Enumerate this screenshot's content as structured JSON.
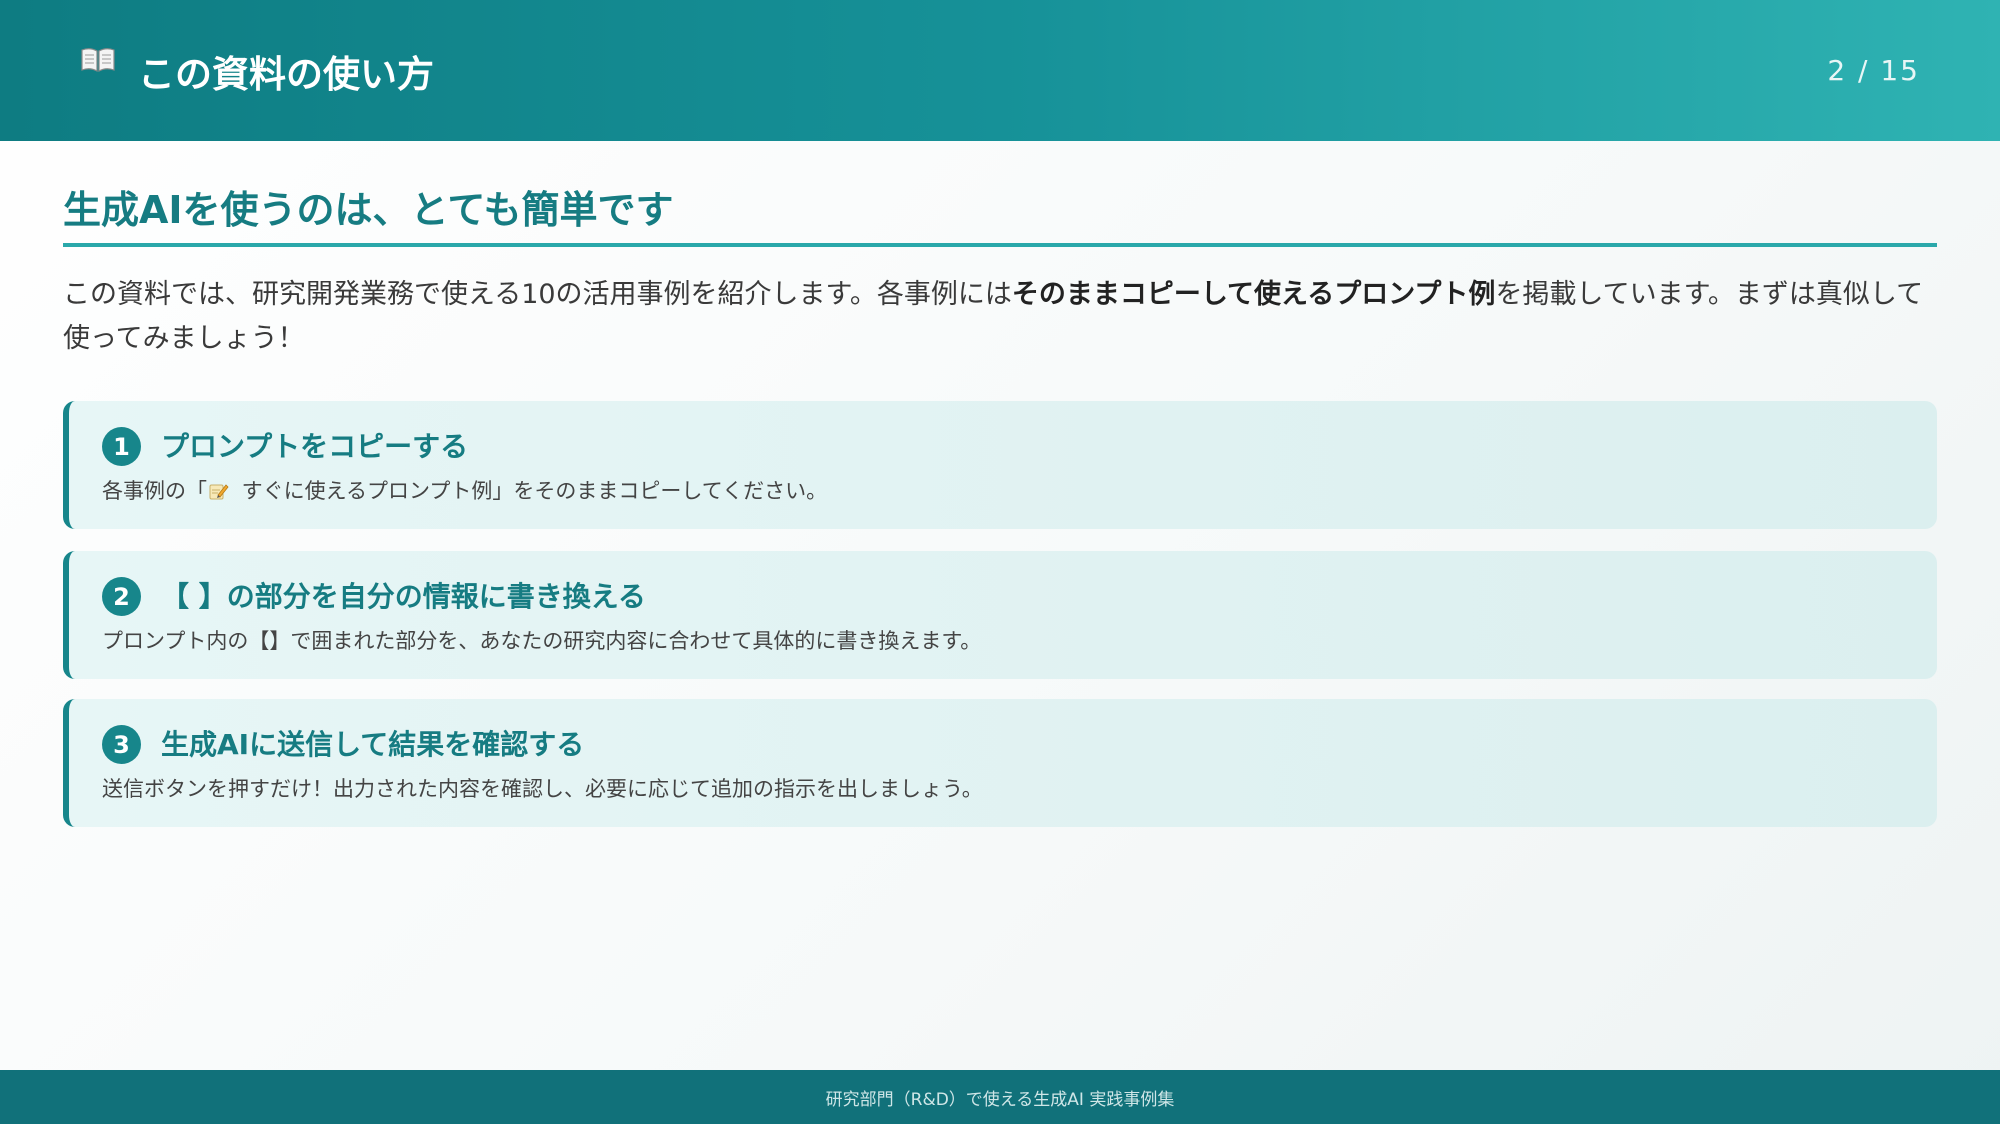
{
  "header": {
    "icon": "open-book-icon",
    "title": "この資料の使い方",
    "page": "2 / 15"
  },
  "main": {
    "subtitle": "生成AIを使うのは、とても簡単です",
    "intro": {
      "before": "この資料では、研究開発業務で使える10の活用事例を紹介します。各事例には",
      "bold": "そのままコピーして使えるプロンプト例",
      "after": "を掲載しています。まずは真似して使ってみましょう！"
    },
    "steps": [
      {
        "number": "1",
        "title": "プロンプトをコピーする",
        "desc_before": "各事例の「",
        "desc_icon": "pencil-memo-icon",
        "desc_after": " すぐに使えるプロンプト例」をそのままコピーしてください。"
      },
      {
        "number": "2",
        "title": "【 】の部分を自分の情報に書き換える",
        "desc": "プロンプト内の【】で囲まれた部分を、あなたの研究内容に合わせて具体的に書き換えます。"
      },
      {
        "number": "3",
        "title": "生成AIに送信して結果を確認する",
        "desc": "送信ボタンを押すだけ！出力された内容を確認し、必要に応じて追加の指示を出しましょう。"
      }
    ]
  },
  "footer": {
    "text": "研究部門（R&D）で使える生成AI 実践事例集"
  },
  "colors": {
    "header_start": "#0e7c82",
    "header_end": "#2fb3b3",
    "accent": "#167c82",
    "step_bg": "#e4f4f4",
    "footer_bg": "#11717a"
  }
}
